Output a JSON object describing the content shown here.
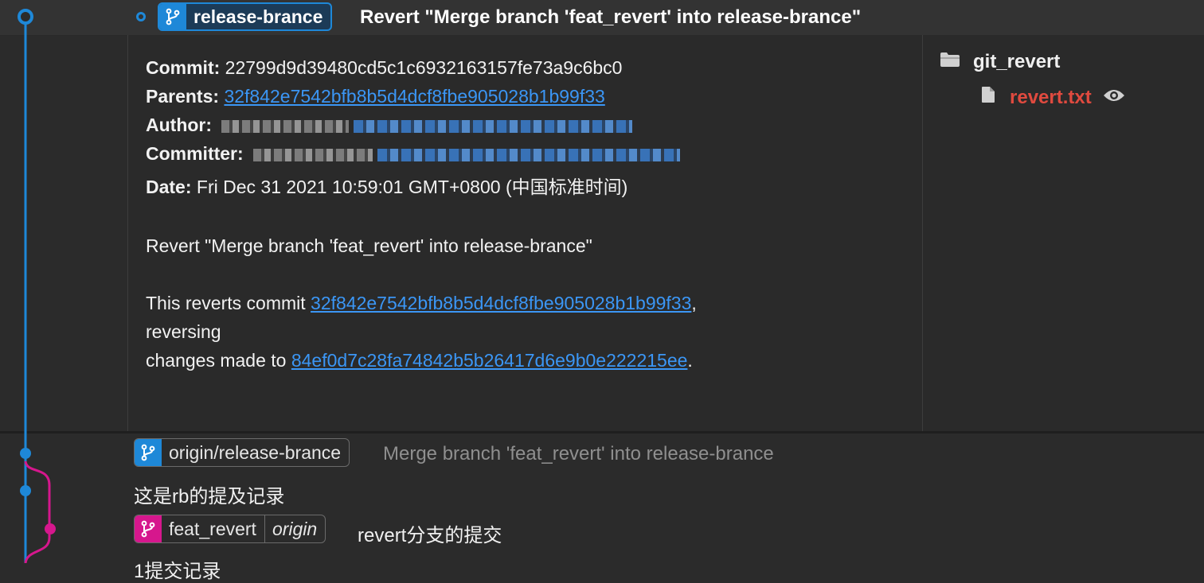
{
  "colors": {
    "accent_blue": "#1e88d8",
    "branch_pink": "#d6178d",
    "link_blue": "#3b96f5",
    "modified_file_red": "#e04a3f"
  },
  "selected_commit": {
    "branch_label": "release-brance",
    "branch_icon": "git-branch-icon",
    "subject": "Revert \"Merge branch 'feat_revert' into release-brance\""
  },
  "commit_details": {
    "commit_label": "Commit:",
    "commit_hash": "22799d9d39480cd5c1c6932163157fe73a9c6bc0",
    "parents_label": "Parents:",
    "parents_hash": "32f842e7542bfb8b5d4dcf8fbe905028b1b99f33",
    "author_label": "Author:",
    "committer_label": "Committer:",
    "date_label": "Date:",
    "date_value": "Fri Dec 31 2021 10:59:01 GMT+0800 (中国标准时间)",
    "message_title": "Revert \"Merge branch 'feat_revert' into release-brance\"",
    "message_line1_prefix": "This reverts commit ",
    "message_line1_hash": "32f842e7542bfb8b5d4dcf8fbe905028b1b99f33",
    "message_line1_suffix": ",",
    "message_line2": "reversing",
    "message_line3_prefix": "changes made to ",
    "message_line3_hash": "84ef0d7c28fa74842b5b26417d6e9b0e222215ee",
    "message_line3_suffix": "."
  },
  "changed_files": {
    "folder_name": "git_revert",
    "folder_icon": "folder-icon",
    "file_name": "revert.txt",
    "file_icon": "file-icon",
    "view_icon": "eye-icon"
  },
  "commits": [
    {
      "branch_label": "origin/release-brance",
      "subject": "Merge branch 'feat_revert' into release-brance"
    },
    {
      "subject": "这是rb的提及记录"
    },
    {
      "branch_label": "feat_revert",
      "remote_label": "origin",
      "subject": "revert分支的提交"
    },
    {
      "subject": "1提交记录"
    }
  ]
}
